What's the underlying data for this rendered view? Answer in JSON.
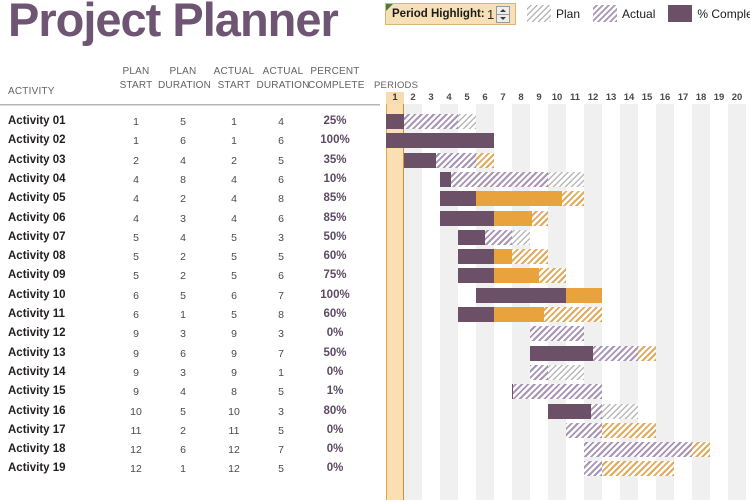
{
  "title": "Project Planner",
  "period_highlight": {
    "label": "Period Highlight:",
    "value": "1",
    "spinner_up_icon": "caret-up-icon",
    "spinner_down_icon": "caret-down-icon"
  },
  "legend": [
    {
      "label": "Plan",
      "swatch": "plan-hatch",
      "color": "#b9b9b9"
    },
    {
      "label": "Actual",
      "swatch": "actual-hatch",
      "color": "#a894b5"
    },
    {
      "label": "% Complete",
      "swatch": "complete-solid",
      "color": "#6b5068"
    }
  ],
  "colors": {
    "title": "#6e5573",
    "complete": "#6b5068",
    "actual_hatch": "#a894b5",
    "plan_hatch": "#b9b9b9",
    "overrun_solid": "#e8a33d",
    "overrun_hatch": "#e0aa5c",
    "highlight_column": "#fadfb4",
    "control_bg": "#f7e0b5",
    "zebra": "#f0f0f0"
  },
  "table": {
    "headers": {
      "activity": "ACTIVITY",
      "plan_start": [
        "PLAN",
        "START"
      ],
      "plan_duration": [
        "PLAN",
        "DURATION"
      ],
      "actual_start": [
        "ACTUAL",
        "START"
      ],
      "actual_duration": [
        "ACTUAL",
        "DURATION"
      ],
      "percent_complete": [
        "PERCENT",
        "COMPLETE"
      ],
      "periods": "PERIODS"
    },
    "periods": [
      "1",
      "2",
      "3",
      "4",
      "5",
      "6",
      "7",
      "8",
      "9",
      "10",
      "11",
      "12",
      "13",
      "14",
      "15",
      "16",
      "17",
      "18",
      "19",
      "20"
    ],
    "highlighted_period": 1,
    "rows": [
      {
        "activity": "Activity 01",
        "plan_start": "1",
        "plan_duration": "5",
        "actual_start": "1",
        "actual_duration": "4",
        "percent_complete": "25%"
      },
      {
        "activity": "Activity 02",
        "plan_start": "1",
        "plan_duration": "6",
        "actual_start": "1",
        "actual_duration": "6",
        "percent_complete": "100%"
      },
      {
        "activity": "Activity 03",
        "plan_start": "2",
        "plan_duration": "4",
        "actual_start": "2",
        "actual_duration": "5",
        "percent_complete": "35%"
      },
      {
        "activity": "Activity 04",
        "plan_start": "4",
        "plan_duration": "8",
        "actual_start": "4",
        "actual_duration": "6",
        "percent_complete": "10%"
      },
      {
        "activity": "Activity 05",
        "plan_start": "4",
        "plan_duration": "2",
        "actual_start": "4",
        "actual_duration": "8",
        "percent_complete": "85%"
      },
      {
        "activity": "Activity 06",
        "plan_start": "4",
        "plan_duration": "3",
        "actual_start": "4",
        "actual_duration": "6",
        "percent_complete": "85%"
      },
      {
        "activity": "Activity 07",
        "plan_start": "5",
        "plan_duration": "4",
        "actual_start": "5",
        "actual_duration": "3",
        "percent_complete": "50%"
      },
      {
        "activity": "Activity 08",
        "plan_start": "5",
        "plan_duration": "2",
        "actual_start": "5",
        "actual_duration": "5",
        "percent_complete": "60%"
      },
      {
        "activity": "Activity 09",
        "plan_start": "5",
        "plan_duration": "2",
        "actual_start": "5",
        "actual_duration": "6",
        "percent_complete": "75%"
      },
      {
        "activity": "Activity 10",
        "plan_start": "6",
        "plan_duration": "5",
        "actual_start": "6",
        "actual_duration": "7",
        "percent_complete": "100%"
      },
      {
        "activity": "Activity 11",
        "plan_start": "6",
        "plan_duration": "1",
        "actual_start": "5",
        "actual_duration": "8",
        "percent_complete": "60%"
      },
      {
        "activity": "Activity 12",
        "plan_start": "9",
        "plan_duration": "3",
        "actual_start": "9",
        "actual_duration": "3",
        "percent_complete": "0%"
      },
      {
        "activity": "Activity 13",
        "plan_start": "9",
        "plan_duration": "6",
        "actual_start": "9",
        "actual_duration": "7",
        "percent_complete": "50%"
      },
      {
        "activity": "Activity 14",
        "plan_start": "9",
        "plan_duration": "3",
        "actual_start": "9",
        "actual_duration": "1",
        "percent_complete": "0%"
      },
      {
        "activity": "Activity 15",
        "plan_start": "9",
        "plan_duration": "4",
        "actual_start": "8",
        "actual_duration": "5",
        "percent_complete": "1%"
      },
      {
        "activity": "Activity 16",
        "plan_start": "10",
        "plan_duration": "5",
        "actual_start": "10",
        "actual_duration": "3",
        "percent_complete": "80%"
      },
      {
        "activity": "Activity 17",
        "plan_start": "11",
        "plan_duration": "2",
        "actual_start": "11",
        "actual_duration": "5",
        "percent_complete": "0%"
      },
      {
        "activity": "Activity 18",
        "plan_start": "12",
        "plan_duration": "6",
        "actual_start": "12",
        "actual_duration": "7",
        "percent_complete": "0%"
      },
      {
        "activity": "Activity 19",
        "plan_start": "12",
        "plan_duration": "1",
        "actual_start": "12",
        "actual_duration": "5",
        "percent_complete": "0%"
      }
    ]
  },
  "chart_data": {
    "type": "bar",
    "title": "Project Planner",
    "xlabel": "PERIODS",
    "ylabel": "ACTIVITY",
    "xlim": [
      1,
      20
    ],
    "grid": true,
    "legend": [
      "Plan",
      "Actual",
      "% Complete"
    ],
    "categories": [
      "Activity 01",
      "Activity 02",
      "Activity 03",
      "Activity 04",
      "Activity 05",
      "Activity 06",
      "Activity 07",
      "Activity 08",
      "Activity 09",
      "Activity 10",
      "Activity 11",
      "Activity 12",
      "Activity 13",
      "Activity 14",
      "Activity 15",
      "Activity 16",
      "Activity 17",
      "Activity 18",
      "Activity 19"
    ],
    "series": [
      {
        "name": "Plan Start",
        "values": [
          1,
          1,
          2,
          4,
          4,
          4,
          5,
          5,
          5,
          6,
          6,
          9,
          9,
          9,
          9,
          10,
          11,
          12,
          12
        ]
      },
      {
        "name": "Plan Duration",
        "values": [
          5,
          6,
          4,
          8,
          2,
          3,
          4,
          2,
          2,
          5,
          1,
          3,
          6,
          3,
          4,
          5,
          2,
          6,
          1
        ]
      },
      {
        "name": "Actual Start",
        "values": [
          1,
          1,
          2,
          4,
          4,
          4,
          5,
          5,
          5,
          6,
          5,
          9,
          9,
          9,
          8,
          10,
          11,
          12,
          12
        ]
      },
      {
        "name": "Actual Duration",
        "values": [
          4,
          6,
          5,
          6,
          8,
          6,
          3,
          5,
          6,
          7,
          8,
          3,
          7,
          1,
          5,
          3,
          5,
          7,
          5
        ]
      },
      {
        "name": "Percent Complete",
        "values": [
          25,
          100,
          35,
          10,
          85,
          85,
          50,
          60,
          75,
          100,
          60,
          0,
          50,
          0,
          1,
          80,
          0,
          0,
          0
        ]
      }
    ]
  }
}
